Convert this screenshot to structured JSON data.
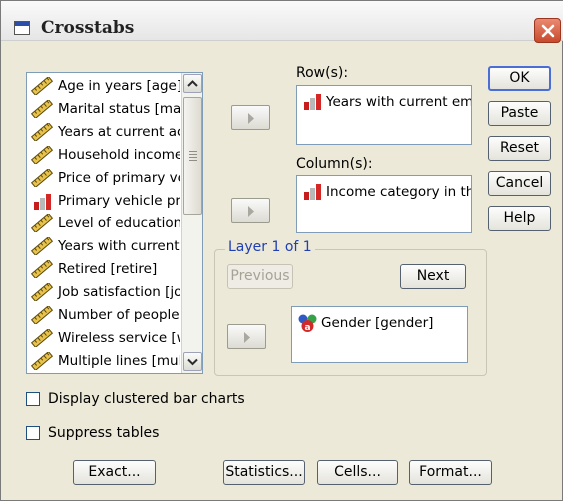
{
  "window": {
    "title": "Crosstabs"
  },
  "variables": {
    "items": [
      {
        "label": "Age in years [age]",
        "type": "scale"
      },
      {
        "label": "Marital status [mari",
        "type": "scale"
      },
      {
        "label": "Years at current ac",
        "type": "scale"
      },
      {
        "label": "Household income",
        "type": "scale"
      },
      {
        "label": "Price of primary ve",
        "type": "scale"
      },
      {
        "label": "Primary vehicle pric",
        "type": "ordinal"
      },
      {
        "label": "Level of education",
        "type": "scale"
      },
      {
        "label": "Years with current",
        "type": "scale"
      },
      {
        "label": "Retired [retire]",
        "type": "scale"
      },
      {
        "label": "Job satisfaction [jo",
        "type": "scale"
      },
      {
        "label": "Number of people",
        "type": "scale"
      },
      {
        "label": "Wireless service [w",
        "type": "scale"
      },
      {
        "label": "Multiple lines [multl",
        "type": "scale"
      }
    ]
  },
  "rows": {
    "label": "Row(s):",
    "items": [
      "Years with current emp"
    ]
  },
  "columns": {
    "label": "Column(s):",
    "items": [
      "Income category in the"
    ]
  },
  "layer": {
    "title": "Layer 1 of 1",
    "previous_label": "Previous",
    "next_label": "Next",
    "items": [
      "Gender [gender]"
    ]
  },
  "side_buttons": {
    "ok": "OK",
    "paste": "Paste",
    "reset": "Reset",
    "cancel": "Cancel",
    "help": "Help"
  },
  "options": {
    "clustered_bar": {
      "label": "Display clustered bar charts",
      "checked": false
    },
    "suppress_tables": {
      "label": "Suppress tables",
      "checked": false
    }
  },
  "bottom_buttons": {
    "exact": "Exact...",
    "statistics": "Statistics...",
    "cells": "Cells...",
    "format": "Format..."
  },
  "colors": {
    "accent": "#1f3fb4",
    "close": "#c94a2c",
    "dialog_bg": "#ece9d8"
  }
}
